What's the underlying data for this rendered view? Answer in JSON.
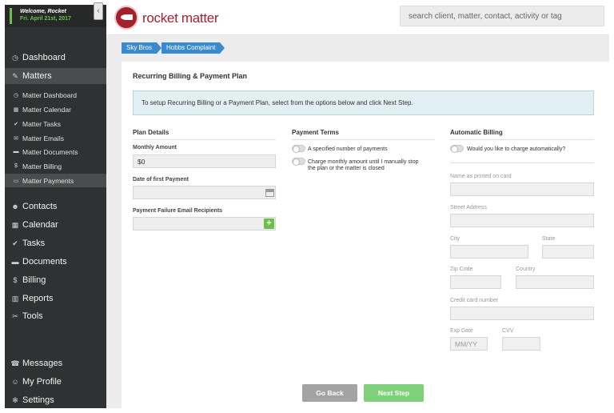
{
  "welcome": {
    "name": "Welcome, Rocket",
    "date": "Fri. April 21st, 2017"
  },
  "sidebar": {
    "collapse_glyph": "‹",
    "main_items": [
      {
        "label": "Dashboard",
        "icon": "dashboard-icon"
      },
      {
        "label": "Matters",
        "icon": "gavel-icon"
      }
    ],
    "sub_items": [
      {
        "label": "Matter Dashboard",
        "icon": "dashboard-icon"
      },
      {
        "label": "Matter Calendar",
        "icon": "calendar-icon"
      },
      {
        "label": "Matter Tasks",
        "icon": "check-icon"
      },
      {
        "label": "Matter Emails",
        "icon": "envelope-icon"
      },
      {
        "label": "Matter Documents",
        "icon": "folder-icon"
      },
      {
        "label": "Matter Billing",
        "icon": "dollar-icon"
      },
      {
        "label": "Matter Payments",
        "icon": "credit-card-icon"
      }
    ],
    "other_items": [
      {
        "label": "Contacts",
        "icon": "users-icon"
      },
      {
        "label": "Calendar",
        "icon": "calendar-icon"
      },
      {
        "label": "Tasks",
        "icon": "check-icon"
      },
      {
        "label": "Documents",
        "icon": "folder-icon"
      },
      {
        "label": "Billing",
        "icon": "dollar-icon"
      },
      {
        "label": "Reports",
        "icon": "bar-chart-icon"
      },
      {
        "label": "Tools",
        "icon": "wrench-icon"
      }
    ],
    "bottom_items": [
      {
        "label": "Messages",
        "icon": "phone-icon"
      },
      {
        "label": "My Profile",
        "icon": "user-icon"
      },
      {
        "label": "Settings",
        "icon": "gear-icon"
      }
    ]
  },
  "header": {
    "logo_text": "rocket matter",
    "search_placeholder": "search client, matter, contact, activity or tag"
  },
  "breadcrumb": [
    "Sky Bros",
    "Hobbs Complaint"
  ],
  "panel": {
    "title": "Recurring Billing & Payment Plan",
    "info": "To setup Recurring Billing or a Payment Plan, select from the options below and click Next Step."
  },
  "plan_details": {
    "title": "Plan Details",
    "monthly_amount_label": "Monthly Amount",
    "monthly_amount_value": "$0",
    "first_payment_label": "Date of first Payment",
    "first_payment_value": "",
    "recipients_label": "Payment Failure Email Recipients",
    "recipients_value": "",
    "add_glyph": "+"
  },
  "payment_terms": {
    "title": "Payment Terms",
    "option_1": "A specified number of payments",
    "option_2a": "Charge monthly amount until I manually stop",
    "option_2b": "the plan or the matter is closed"
  },
  "automatic_billing": {
    "title": "Automatic Billing",
    "toggle_label": "Would you like to charge automatically?",
    "name_label": "Name as printed on card",
    "street_label": "Street Address",
    "city_label": "City",
    "state_label": "State",
    "zip_label": "Zip Code",
    "country_label": "Country",
    "card_label": "Credit card number",
    "exp_label": "Exp Date",
    "exp_placeholder": "MM/YY",
    "cvv_label": "CVV"
  },
  "buttons": {
    "back": "Go Back",
    "next": "Next Step"
  },
  "colors": {
    "accent_green": "#6cc04a",
    "brand_red": "#a51f2d",
    "breadcrumb_blue": "#3a8ad0",
    "back_gray": "#a3a3a3",
    "next_green": "#7ed07a"
  }
}
